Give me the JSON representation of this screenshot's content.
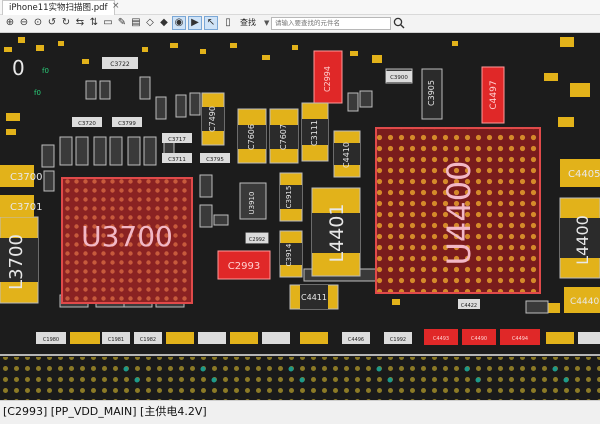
{
  "window": {
    "tab_title": "iPhone11实物扫描图.pdf",
    "tab_close": "×"
  },
  "toolbar": {
    "search_label": "查找",
    "search_dropdown": "▼",
    "search_placeholder": "请输入要查找的元件名"
  },
  "colors": {
    "board": "#1c1c1c",
    "pad_gold": "#e2b21a",
    "selected": "#e02828",
    "bga": "#7a1c1c"
  },
  "board": {
    "big_labels": {
      "u3700": "U3700",
      "u4400": "U4400",
      "l4401": "L4401",
      "l3700": "L3700",
      "l4400": "L4400",
      "c2993": "C2993"
    },
    "labels": {
      "c3722": "C3722",
      "c2994": "C2994",
      "c3900": "C3900",
      "c3905": "C3905",
      "c4497": "C4497",
      "c7490": "C7490",
      "c7606": "C7606",
      "c7607": "C7607",
      "c3111": "C3111",
      "c4410": "C4410",
      "c3717": "C3717",
      "c3711": "C3711",
      "c3795": "C3795",
      "c3720": "C3720",
      "c3799": "C3799",
      "c3700": "C3700",
      "c3701": "C3701",
      "c4405": "C4405",
      "u3910": "U3910",
      "c3915": "C3915",
      "c3914": "C3914",
      "c4411": "C4411",
      "c4422": "C4422",
      "c2992": "C2992",
      "c1980": "C1980",
      "c1981": "C1981",
      "c1982": "C1982",
      "c4496": "C4496",
      "c1992": "C1992",
      "c4493": "C4493",
      "c4490": "C4490",
      "c4494": "C4494",
      "c4440": "C4440",
      "zero": "0",
      "f0a": "f0",
      "f0b": "f0"
    }
  },
  "status": {
    "text": "[C2993] [PP_VDD_MAIN] [主供电4.2V]"
  }
}
